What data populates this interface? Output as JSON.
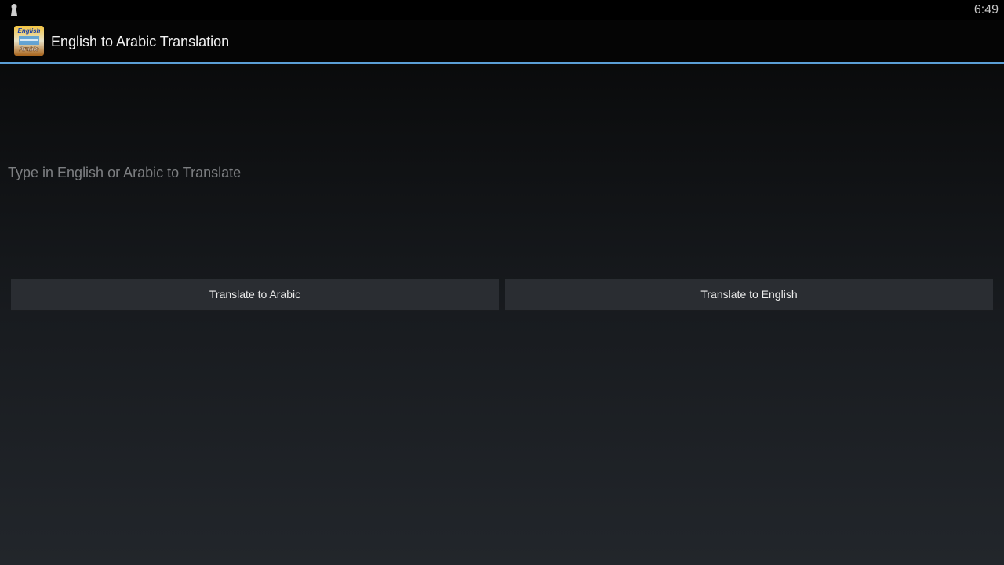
{
  "status_bar": {
    "notification_icon": "keyhole-icon",
    "time": "6:49"
  },
  "action_bar": {
    "app_icon": "app-logo-icon",
    "app_icon_text_top": "English",
    "app_icon_text_bottom": "Arabic",
    "title": "English to Arabic Translation",
    "divider_color": "#5b9fd6"
  },
  "main": {
    "input": {
      "value": "",
      "placeholder": "Type in English or Arabic to Translate"
    },
    "buttons": {
      "translate_to_arabic": "Translate to Arabic",
      "translate_to_english": "Translate to English"
    }
  }
}
